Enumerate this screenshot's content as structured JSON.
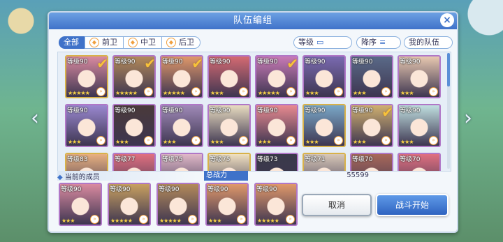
{
  "dialog": {
    "title": "队伍编组",
    "close_glyph": "×"
  },
  "filters": [
    {
      "label": "全部",
      "active": true
    },
    {
      "label": "前卫",
      "icon": "front-icon"
    },
    {
      "label": "中卫",
      "icon": "mid-icon"
    },
    {
      "label": "后卫",
      "icon": "back-icon"
    }
  ],
  "sort": {
    "level_label": "等级",
    "order_label": "降序",
    "my_team_label": "我的队伍"
  },
  "roster": [
    {
      "level": "等级90",
      "stars": "★★★★★",
      "check": true,
      "color": "#d98aa0",
      "frame": "gold"
    },
    {
      "level": "等级90",
      "stars": "★★★★★",
      "check": true,
      "color": "#b38a5a",
      "frame": "purple"
    },
    {
      "level": "等级90",
      "stars": "★★★★★",
      "check": true,
      "color": "#e0986a",
      "frame": "purple"
    },
    {
      "level": "等级90",
      "stars": "★★★",
      "check": false,
      "color": "#d46a72",
      "frame": "purple"
    },
    {
      "level": "等级90",
      "stars": "★★★★★",
      "check": true,
      "color": "#c87ab6",
      "frame": "purple"
    },
    {
      "level": "等级90",
      "stars": "★★★",
      "check": false,
      "color": "#7a6ab0",
      "frame": "purple"
    },
    {
      "level": "等级90",
      "stars": "★★★",
      "check": false,
      "color": "#5a6a88",
      "frame": "purple"
    },
    {
      "level": "等级90",
      "stars": "★★★",
      "check": false,
      "color": "#e8c8b0",
      "frame": "purple"
    },
    {
      "level": "等级90",
      "stars": "★★★",
      "check": false,
      "color": "#9a88d0",
      "frame": "purple"
    },
    {
      "level": "等级90",
      "stars": "★★★",
      "check": false,
      "color": "#4a3a3a",
      "frame": "purple"
    },
    {
      "level": "等级90",
      "stars": "★★★",
      "check": false,
      "color": "#a08ab8",
      "frame": "purple"
    },
    {
      "level": "等级90",
      "stars": "★★★",
      "check": false,
      "color": "#e8dcc0",
      "frame": "purple"
    },
    {
      "level": "等级90",
      "stars": "★★★",
      "check": false,
      "color": "#e88a90",
      "frame": "purple"
    },
    {
      "level": "等级90",
      "stars": "★★★",
      "check": false,
      "color": "#7aa8c8",
      "frame": "gold"
    },
    {
      "level": "等级90",
      "stars": "★★★",
      "check": true,
      "color": "#d0b070",
      "frame": "purple"
    },
    {
      "level": "等级90",
      "stars": "★★★",
      "check": false,
      "color": "#c0e0e0",
      "frame": "purple"
    },
    {
      "level": "等级83",
      "stars": "",
      "check": false,
      "color": "#e8b080",
      "frame": "gold"
    },
    {
      "level": "等级77",
      "stars": "",
      "check": false,
      "color": "#e07080",
      "frame": "purple"
    },
    {
      "level": "等级75",
      "stars": "",
      "check": false,
      "color": "#e0b8c8",
      "frame": "purple"
    },
    {
      "level": "等级75",
      "stars": "",
      "check": false,
      "color": "#f0e0c0",
      "frame": "gold"
    },
    {
      "level": "等级73",
      "stars": "",
      "check": false,
      "color": "#3a3a4a",
      "frame": "purple"
    },
    {
      "level": "等级71",
      "stars": "",
      "check": false,
      "color": "#d8c8b8",
      "frame": "gold"
    },
    {
      "level": "等级70",
      "stars": "",
      "check": false,
      "color": "#a8685a",
      "frame": "purple"
    },
    {
      "level": "等级70",
      "stars": "",
      "check": false,
      "color": "#e07080",
      "frame": "purple"
    }
  ],
  "members_label": "当前的成员",
  "power": {
    "label": "总战力",
    "value": "55599"
  },
  "members": [
    {
      "level": "等级90",
      "stars": "★★★",
      "color": "#d98aa0"
    },
    {
      "level": "等级90",
      "stars": "★★★★★",
      "color": "#c8a060"
    },
    {
      "level": "等级90",
      "stars": "★★★★★",
      "color": "#b38a5a"
    },
    {
      "level": "等级90",
      "stars": "★★★",
      "color": "#e0986a"
    },
    {
      "level": "等级90",
      "stars": "★★★★★",
      "color": "#e0986a"
    }
  ],
  "buttons": {
    "cancel": "取消",
    "start": "战斗开始"
  },
  "nav": {
    "left": "‹",
    "right": "›"
  }
}
